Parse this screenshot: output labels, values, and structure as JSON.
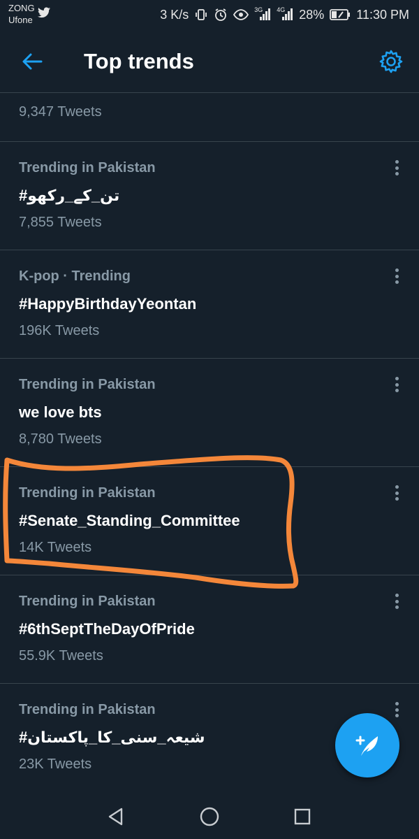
{
  "status_bar": {
    "carrier_1": "ZONG",
    "carrier_2": "Ufone",
    "network_speed": "3 K/s",
    "signal_1_label": "3G",
    "signal_2_label": "4G",
    "battery": "28%",
    "time": "11:30 PM"
  },
  "header": {
    "title": "Top trends"
  },
  "partial_item": {
    "count": "9,347 Tweets"
  },
  "trends": [
    {
      "meta": "Trending in Pakistan",
      "name": "#تن_کے_رکھو",
      "count": "7,855 Tweets"
    },
    {
      "meta": "K-pop · Trending",
      "name": "#HappyBirthdayYeontan",
      "count": "196K Tweets"
    },
    {
      "meta": "Trending in Pakistan",
      "name": "we love bts",
      "count": "8,780 Tweets"
    },
    {
      "meta": "Trending in Pakistan",
      "name": "#Senate_Standing_Committee",
      "count": "14K Tweets"
    },
    {
      "meta": "Trending in Pakistan",
      "name": "#6thSeptTheDayOfPride",
      "count": "55.9K Tweets"
    },
    {
      "meta": "Trending in Pakistan",
      "name": "#شیعہ_سنی_کا_پاکستان",
      "count": "23K Tweets"
    }
  ],
  "colors": {
    "background": "#15202b",
    "accent": "#1da1f2",
    "secondary_text": "#8899a6",
    "divider": "#38444d",
    "highlight_annotation": "#f4873a"
  },
  "icons": {
    "back": "arrow-left-icon",
    "settings": "gear-icon",
    "more": "vertical-dots-icon",
    "compose": "compose-tweet-icon",
    "nav_back": "triangle-back-icon",
    "nav_home": "circle-home-icon",
    "nav_recents": "square-recents-icon"
  }
}
